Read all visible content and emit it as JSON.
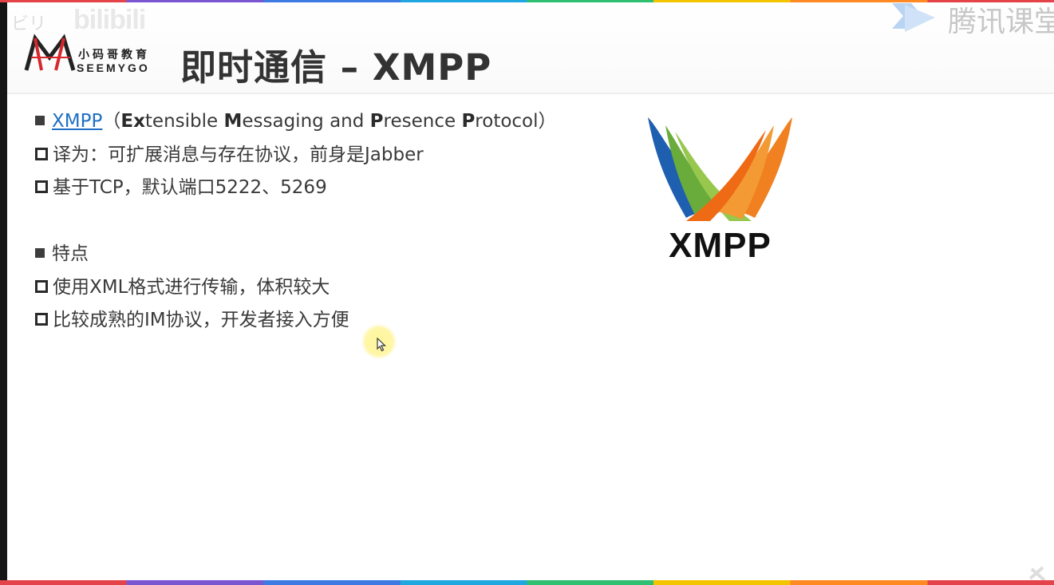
{
  "watermarks": {
    "top_left_mark": "ビリ",
    "bilibili": "bilibili",
    "tencent": "腾讯课堂"
  },
  "logo": {
    "cn": "小码哥教育",
    "en": "SEEMYGO"
  },
  "slide": {
    "title": "即时通信 – XMPP",
    "section1": {
      "link": "XMPP",
      "open_paren": "（",
      "e1": "E",
      "x1": "x",
      "r1": "tensible ",
      "m1": "M",
      "r2": "essaging and ",
      "p1": "P",
      "r3": "resence ",
      "p2": "P",
      "r4": "rotocol）",
      "items": [
        "译为：可扩展消息与存在协议，前身是Jabber",
        "基于TCP，默认端口5222、5269"
      ]
    },
    "section2": {
      "heading": "特点",
      "items": [
        "使用XML格式进行传输，体积较大",
        "比较成熟的IM协议，开发者接入方便"
      ]
    },
    "logo_text": "XMPP"
  },
  "colors": {
    "link": "#1f6fc4",
    "logo_blue": "#1f5fb0",
    "logo_green": "#6aac3c",
    "logo_orange": "#f08020",
    "cursor_highlight": "#fff59c"
  },
  "icons": {
    "tencent": "tencent-classroom-play-icon",
    "cursor": "mouse-pointer-icon"
  }
}
